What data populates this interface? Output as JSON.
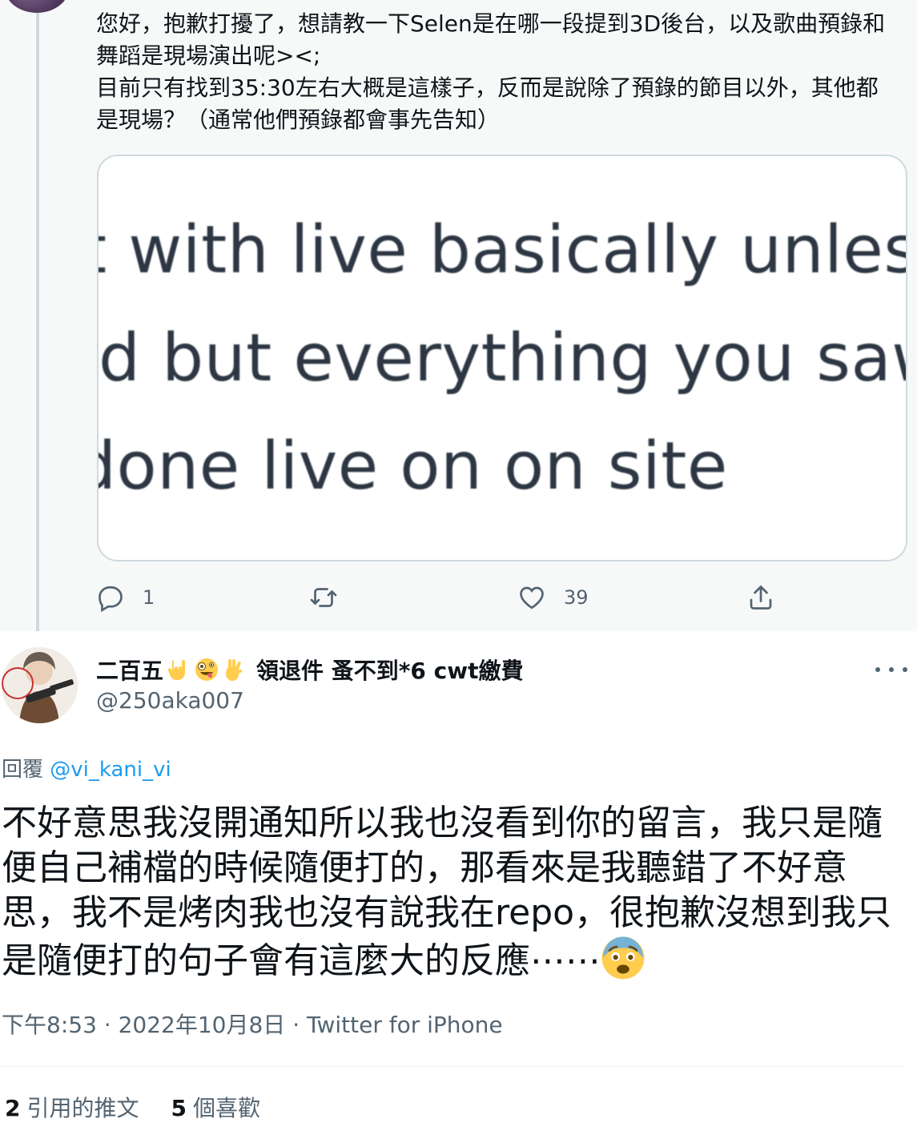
{
  "parent_tweet": {
    "text": "您好，抱歉打擾了，想請教一下Selen是在哪一段提到3D後台，以及歌曲預錄和舞蹈是現場演出呢><;\n目前只有找到35:30左右大概是這樣子，反而是說除了預錄的節目以外，其他都是現場？（通常他們預錄都會事先告知）",
    "media_lines": [
      "t with live basically unless",
      "d but everything you saw",
      "done live on on site"
    ],
    "actions": {
      "reply_count": "1",
      "retweet_count": "",
      "like_count": "39"
    }
  },
  "main_tweet": {
    "author_name_prefix": "二百五",
    "author_name_suffix": "領退件 蚤不到*6 cwt繳費",
    "author_handle": "@250aka007",
    "reply_prefix": "回覆",
    "reply_mention": "@vi_kani_vi",
    "text": "不好意思我沒開通知所以我也沒看到你的留言，我只是隨便自己補檔的時候隨便打的，那看來是我聽錯了不好意思，我不是烤肉我也沒有說我在repo，很抱歉沒想到我只是隨便打的句子會有這麼大的反應⋯⋯",
    "time": "下午8:53",
    "date": "2022年10月8日",
    "separator": " · ",
    "source": "Twitter for iPhone",
    "quote_count": "2",
    "quote_label": "引用的推文",
    "like_count": "5",
    "like_label": "個喜歡"
  },
  "colors": {
    "accent": "#1d9bf0",
    "secondary_text": "#536471",
    "thread_line": "#cfd9de",
    "parent_background": "#f7f9f9"
  },
  "icons": [
    "reply-icon",
    "retweet-icon",
    "like-icon",
    "share-icon",
    "more-icon",
    "rock-hand-emoji",
    "zany-face-emoji",
    "pinching-hand-emoji",
    "anxious-face-emoji"
  ]
}
